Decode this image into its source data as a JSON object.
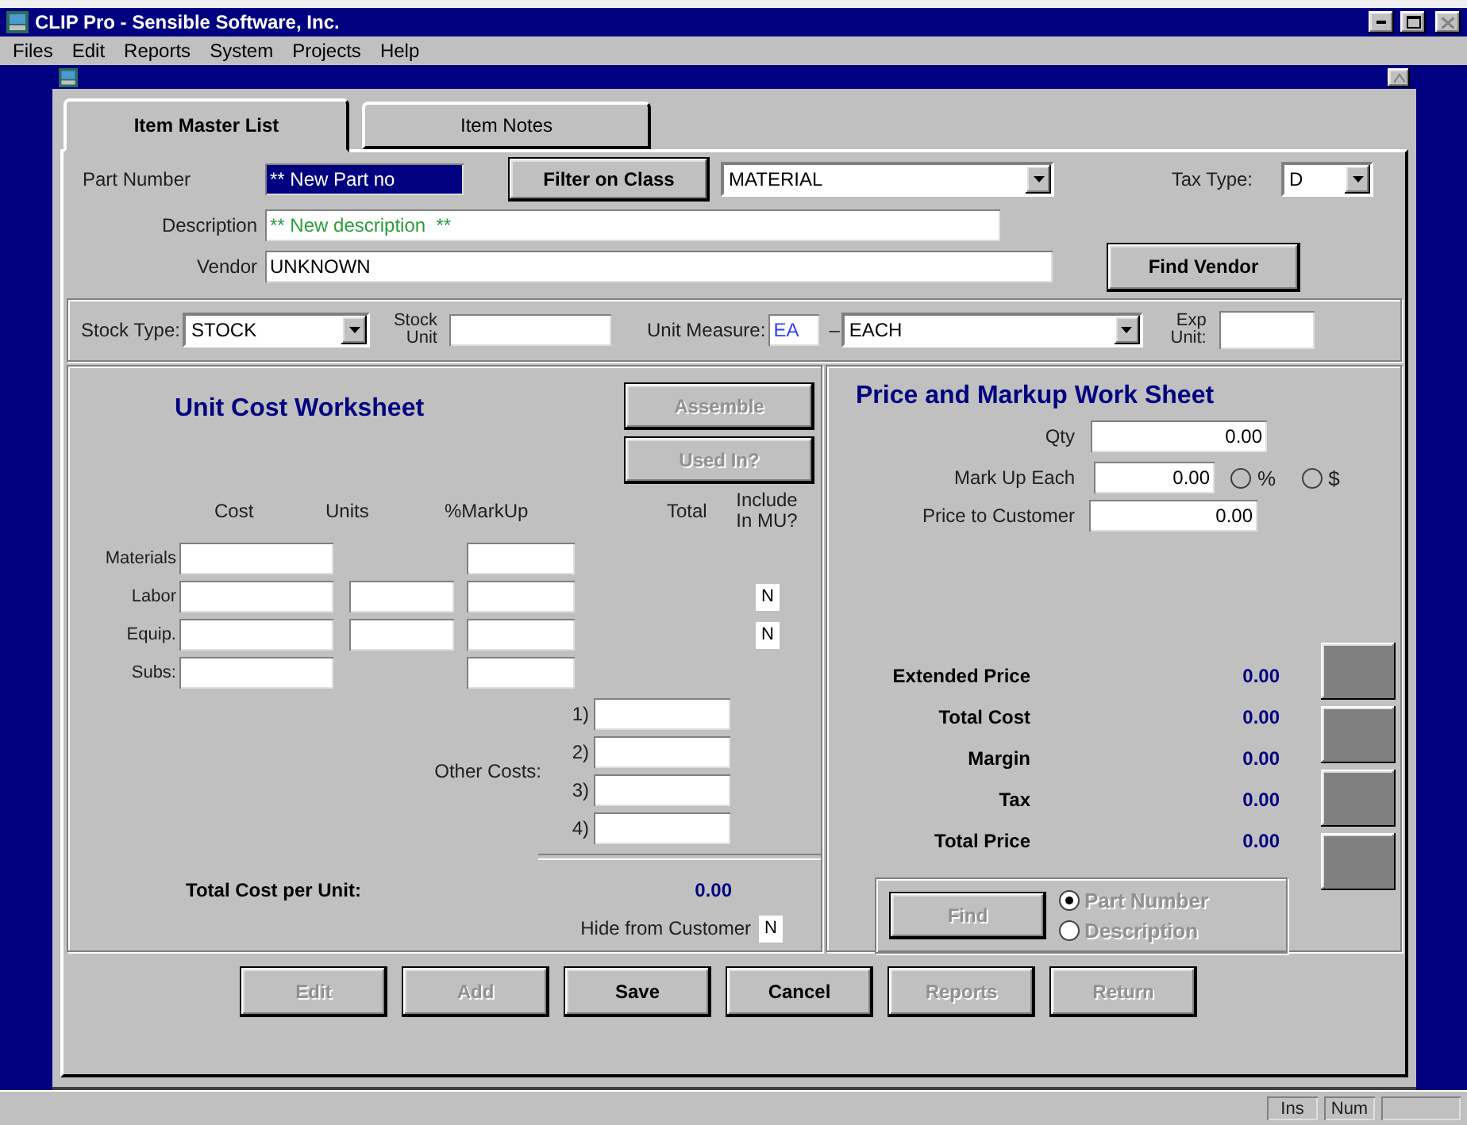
{
  "window": {
    "title": "CLIP Pro - Sensible Software, Inc."
  },
  "menu": [
    {
      "label": "Files"
    },
    {
      "label": "Edit"
    },
    {
      "label": "Reports"
    },
    {
      "label": "System"
    },
    {
      "label": "Projects"
    },
    {
      "label": "Help"
    }
  ],
  "tabs": [
    {
      "label": "Item Master List",
      "selected": true
    },
    {
      "label": "Item Notes",
      "selected": false
    }
  ],
  "part": {
    "part_number_label": "Part Number",
    "part_number": "** New Part no",
    "filter_button": "Filter on Class",
    "class": "MATERIAL",
    "tax_type_label": "Tax Type:",
    "tax_type": "D",
    "description_label": "Description",
    "description": "** New description  **",
    "vendor_label": "Vendor",
    "vendor": "UNKNOWN",
    "find_vendor_button": "Find Vendor"
  },
  "stock": {
    "stock_type_label": "Stock Type:",
    "stock_type": "STOCK",
    "stock_unit_label": "Stock Unit",
    "unit_measure_label": "Unit Measure:",
    "unit_code": "EA",
    "dash": "–",
    "unit_name": "EACH",
    "exp_unit_label": "Exp Unit:"
  },
  "unit_cost": {
    "title": "Unit Cost Worksheet",
    "buttons": [
      {
        "label": "Assemble",
        "disabled": true
      },
      {
        "label": "Used In?",
        "disabled": true
      }
    ],
    "columns": [
      {
        "label": "Cost"
      },
      {
        "label": "Units"
      },
      {
        "label": "%MarkUp"
      },
      {
        "label": "Total"
      },
      {
        "label": "Include In MU?"
      }
    ],
    "rows": [
      {
        "label": "Materials",
        "has_units": false
      },
      {
        "label": "Labor",
        "has_units": true,
        "include": "N"
      },
      {
        "label": "Equip.",
        "has_units": true,
        "include": "N"
      },
      {
        "label": "Subs:",
        "has_units": false
      }
    ],
    "other_costs_label": "Other Costs:",
    "other_costs": [
      {
        "number": "1)"
      },
      {
        "number": "2)"
      },
      {
        "number": "3)"
      },
      {
        "number": "4)"
      }
    ],
    "total_label": "Total Cost per Unit:",
    "total": "0.00",
    "hide_label": "Hide from Customer",
    "hide": "N"
  },
  "price": {
    "title": "Price and Markup Work Sheet",
    "qty_label": "Qty",
    "qty": "0.00",
    "markup_label": "Mark Up Each",
    "markup": "0.00",
    "markup_modes": [
      {
        "label": "%",
        "selected": false
      },
      {
        "label": "$",
        "selected": false
      }
    ],
    "price_label": "Price to Customer",
    "price": "0.00",
    "summary": [
      {
        "label": "Extended Price",
        "value": "0.00"
      },
      {
        "label": "Total Cost",
        "value": "0.00"
      },
      {
        "label": "Margin",
        "value": "0.00"
      },
      {
        "label": "Tax",
        "value": "0.00"
      },
      {
        "label": "Total Price",
        "value": "0.00"
      }
    ],
    "find": {
      "button": "Find",
      "disabled": true,
      "options": [
        {
          "label": "Part Number",
          "selected": true
        },
        {
          "label": "Description",
          "selected": false
        }
      ]
    }
  },
  "buttons": [
    {
      "label": "Edit",
      "disabled": true
    },
    {
      "label": "Add",
      "disabled": true
    },
    {
      "label": "Save",
      "disabled": false
    },
    {
      "label": "Cancel",
      "disabled": false
    },
    {
      "label": "Reports",
      "disabled": true
    },
    {
      "label": "Return",
      "disabled": true
    }
  ],
  "status_bar": [
    "Ins",
    "Num"
  ]
}
